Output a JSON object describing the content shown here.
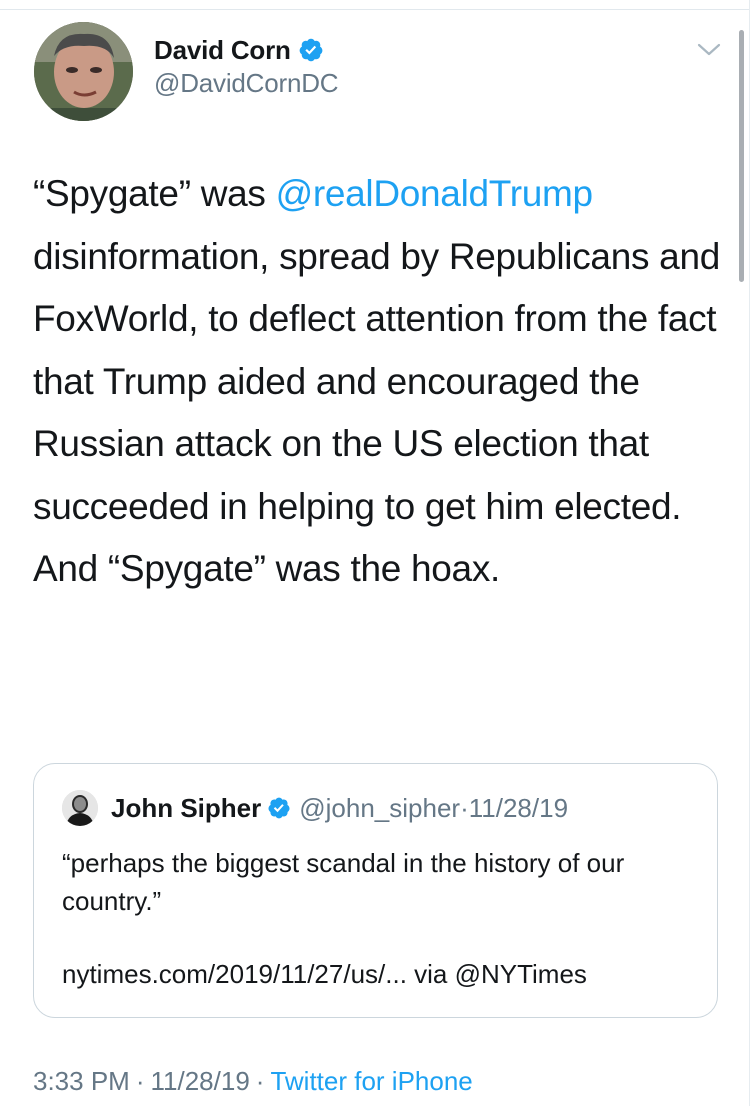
{
  "tweet": {
    "author": {
      "display_name": "David Corn",
      "handle": "@DavidCornDC",
      "verified": true
    },
    "text": {
      "part1": "“Spygate” was ",
      "mention": "@realDonaldTrump",
      "part2": " disinformation, spread by Republicans and FoxWorld, to deflect attention from the fact that Trump aided and encouraged the Russian attack on the US election that succeeded in helping to get him elected. And “Spygate” was the hoax."
    },
    "quoted": {
      "display_name": "John Sipher",
      "handle": "@john_sipher",
      "date_separator": "·",
      "date": "11/28/19",
      "body": "“perhaps the biggest scandal in the history of our country.”",
      "link_line": "nytimes.com/2019/11/27/us/... via @NYTimes"
    },
    "footer": {
      "time": "3:33 PM",
      "separator": "·",
      "date": "11/28/19",
      "source": "Twitter for iPhone"
    }
  },
  "icons": {
    "verified": "verified-badge-icon",
    "menu": "chevron-down-icon"
  },
  "colors": {
    "text": "#14171a",
    "secondary": "#657786",
    "link": "#1da1f2",
    "border": "#ccd6dd"
  }
}
